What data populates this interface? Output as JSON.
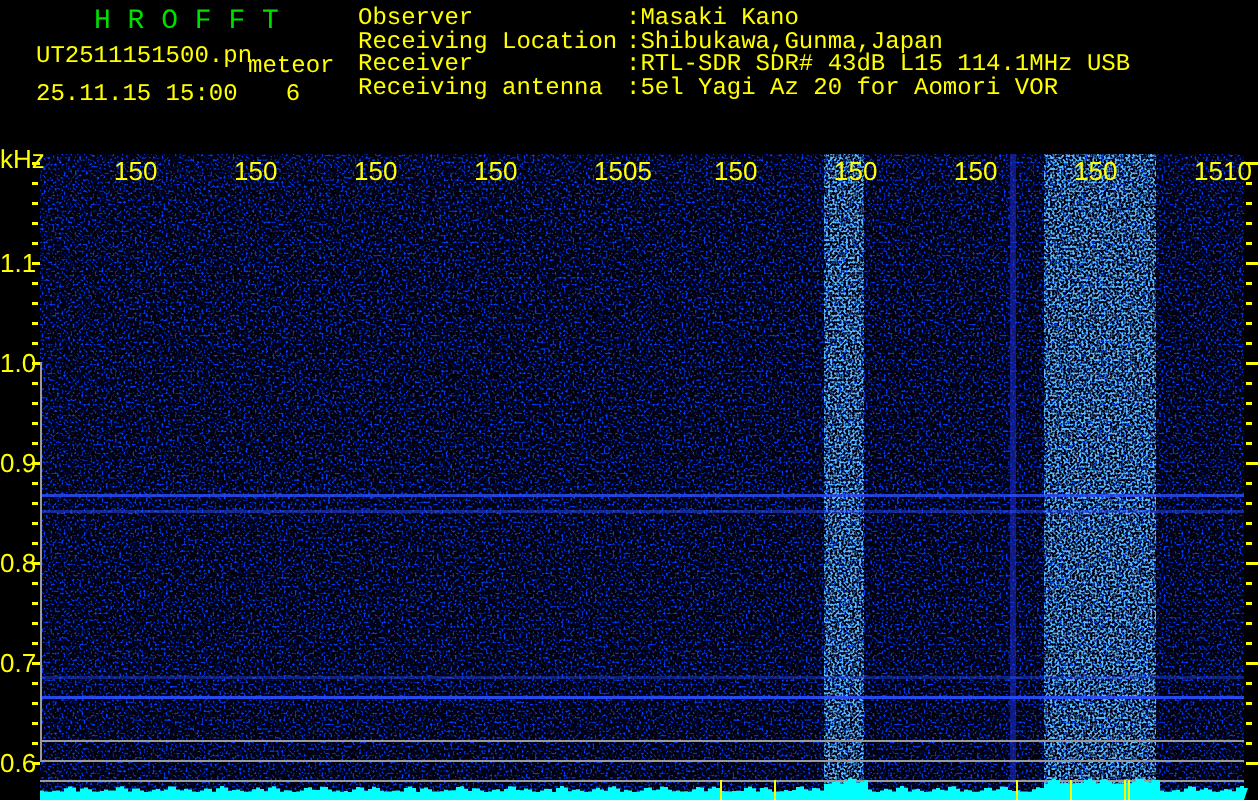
{
  "header": {
    "app_title": "H R O F F T",
    "file_name": "UT2511151500.pn",
    "event_label": "meteor",
    "timestamp": "25.11.15 15:00",
    "event_count": "6"
  },
  "station_info": [
    {
      "label": "Observer",
      "value": ":Masaki Kano"
    },
    {
      "label": "Receiving Location",
      "value": ":Shibukawa,Gunma,Japan"
    },
    {
      "label": "Receiver",
      "value": ":RTL-SDR SDR# 43dB L15 114.1MHz USB"
    },
    {
      "label": "Receiving antenna",
      "value": ":5el Yagi Az 20 for Aomori VOR"
    }
  ],
  "spectrogram": {
    "y_unit": "kHz",
    "y_labels": [
      "1.1",
      "1.0",
      "0.9",
      "0.8",
      "0.7",
      "0.6"
    ],
    "time_labels": [
      "150",
      "150",
      "150",
      "150",
      "1505",
      "150",
      "150",
      "150",
      "150",
      "1510"
    ]
  }
}
